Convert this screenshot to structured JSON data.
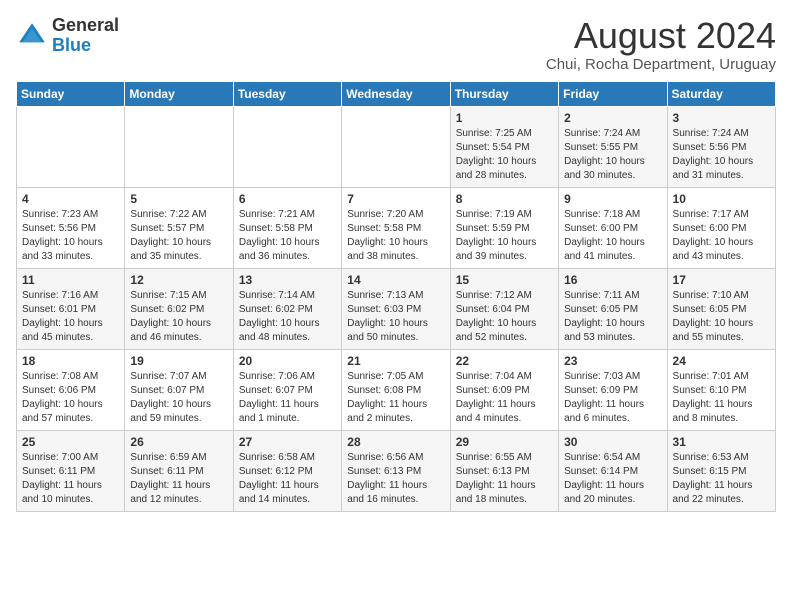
{
  "header": {
    "logo_general": "General",
    "logo_blue": "Blue",
    "month_year": "August 2024",
    "location": "Chui, Rocha Department, Uruguay"
  },
  "days_of_week": [
    "Sunday",
    "Monday",
    "Tuesday",
    "Wednesday",
    "Thursday",
    "Friday",
    "Saturday"
  ],
  "weeks": [
    [
      {
        "day": "",
        "text": ""
      },
      {
        "day": "",
        "text": ""
      },
      {
        "day": "",
        "text": ""
      },
      {
        "day": "",
        "text": ""
      },
      {
        "day": "1",
        "text": "Sunrise: 7:25 AM\nSunset: 5:54 PM\nDaylight: 10 hours and 28 minutes."
      },
      {
        "day": "2",
        "text": "Sunrise: 7:24 AM\nSunset: 5:55 PM\nDaylight: 10 hours and 30 minutes."
      },
      {
        "day": "3",
        "text": "Sunrise: 7:24 AM\nSunset: 5:56 PM\nDaylight: 10 hours and 31 minutes."
      }
    ],
    [
      {
        "day": "4",
        "text": "Sunrise: 7:23 AM\nSunset: 5:56 PM\nDaylight: 10 hours and 33 minutes."
      },
      {
        "day": "5",
        "text": "Sunrise: 7:22 AM\nSunset: 5:57 PM\nDaylight: 10 hours and 35 minutes."
      },
      {
        "day": "6",
        "text": "Sunrise: 7:21 AM\nSunset: 5:58 PM\nDaylight: 10 hours and 36 minutes."
      },
      {
        "day": "7",
        "text": "Sunrise: 7:20 AM\nSunset: 5:58 PM\nDaylight: 10 hours and 38 minutes."
      },
      {
        "day": "8",
        "text": "Sunrise: 7:19 AM\nSunset: 5:59 PM\nDaylight: 10 hours and 39 minutes."
      },
      {
        "day": "9",
        "text": "Sunrise: 7:18 AM\nSunset: 6:00 PM\nDaylight: 10 hours and 41 minutes."
      },
      {
        "day": "10",
        "text": "Sunrise: 7:17 AM\nSunset: 6:00 PM\nDaylight: 10 hours and 43 minutes."
      }
    ],
    [
      {
        "day": "11",
        "text": "Sunrise: 7:16 AM\nSunset: 6:01 PM\nDaylight: 10 hours and 45 minutes."
      },
      {
        "day": "12",
        "text": "Sunrise: 7:15 AM\nSunset: 6:02 PM\nDaylight: 10 hours and 46 minutes."
      },
      {
        "day": "13",
        "text": "Sunrise: 7:14 AM\nSunset: 6:02 PM\nDaylight: 10 hours and 48 minutes."
      },
      {
        "day": "14",
        "text": "Sunrise: 7:13 AM\nSunset: 6:03 PM\nDaylight: 10 hours and 50 minutes."
      },
      {
        "day": "15",
        "text": "Sunrise: 7:12 AM\nSunset: 6:04 PM\nDaylight: 10 hours and 52 minutes."
      },
      {
        "day": "16",
        "text": "Sunrise: 7:11 AM\nSunset: 6:05 PM\nDaylight: 10 hours and 53 minutes."
      },
      {
        "day": "17",
        "text": "Sunrise: 7:10 AM\nSunset: 6:05 PM\nDaylight: 10 hours and 55 minutes."
      }
    ],
    [
      {
        "day": "18",
        "text": "Sunrise: 7:08 AM\nSunset: 6:06 PM\nDaylight: 10 hours and 57 minutes."
      },
      {
        "day": "19",
        "text": "Sunrise: 7:07 AM\nSunset: 6:07 PM\nDaylight: 10 hours and 59 minutes."
      },
      {
        "day": "20",
        "text": "Sunrise: 7:06 AM\nSunset: 6:07 PM\nDaylight: 11 hours and 1 minute."
      },
      {
        "day": "21",
        "text": "Sunrise: 7:05 AM\nSunset: 6:08 PM\nDaylight: 11 hours and 2 minutes."
      },
      {
        "day": "22",
        "text": "Sunrise: 7:04 AM\nSunset: 6:09 PM\nDaylight: 11 hours and 4 minutes."
      },
      {
        "day": "23",
        "text": "Sunrise: 7:03 AM\nSunset: 6:09 PM\nDaylight: 11 hours and 6 minutes."
      },
      {
        "day": "24",
        "text": "Sunrise: 7:01 AM\nSunset: 6:10 PM\nDaylight: 11 hours and 8 minutes."
      }
    ],
    [
      {
        "day": "25",
        "text": "Sunrise: 7:00 AM\nSunset: 6:11 PM\nDaylight: 11 hours and 10 minutes."
      },
      {
        "day": "26",
        "text": "Sunrise: 6:59 AM\nSunset: 6:11 PM\nDaylight: 11 hours and 12 minutes."
      },
      {
        "day": "27",
        "text": "Sunrise: 6:58 AM\nSunset: 6:12 PM\nDaylight: 11 hours and 14 minutes."
      },
      {
        "day": "28",
        "text": "Sunrise: 6:56 AM\nSunset: 6:13 PM\nDaylight: 11 hours and 16 minutes."
      },
      {
        "day": "29",
        "text": "Sunrise: 6:55 AM\nSunset: 6:13 PM\nDaylight: 11 hours and 18 minutes."
      },
      {
        "day": "30",
        "text": "Sunrise: 6:54 AM\nSunset: 6:14 PM\nDaylight: 11 hours and 20 minutes."
      },
      {
        "day": "31",
        "text": "Sunrise: 6:53 AM\nSunset: 6:15 PM\nDaylight: 11 hours and 22 minutes."
      }
    ]
  ]
}
